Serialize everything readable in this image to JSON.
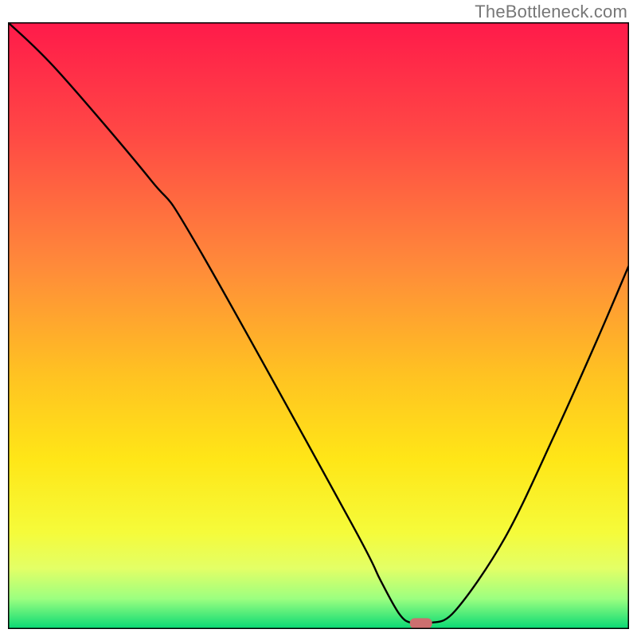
{
  "attribution": "TheBottleneck.com",
  "chart_data": {
    "type": "line",
    "title": "",
    "xlabel": "",
    "ylabel": "",
    "xlim": [
      0,
      100
    ],
    "ylim": [
      0,
      100
    ],
    "x": [
      0,
      8,
      23,
      30,
      55,
      60,
      63,
      65,
      68,
      72,
      80,
      88,
      95,
      100
    ],
    "values": [
      100,
      92,
      74,
      64,
      18,
      8,
      2.5,
      1,
      1,
      3,
      15,
      32,
      48,
      60
    ],
    "marker": {
      "x": 66.5,
      "y": 1
    },
    "gradient_stops": [
      {
        "pct": 0,
        "color": "#ff1a4a"
      },
      {
        "pct": 18,
        "color": "#ff4745"
      },
      {
        "pct": 40,
        "color": "#ff8a3a"
      },
      {
        "pct": 58,
        "color": "#ffc222"
      },
      {
        "pct": 72,
        "color": "#ffe617"
      },
      {
        "pct": 84,
        "color": "#f5fb3a"
      },
      {
        "pct": 90,
        "color": "#e3ff66"
      },
      {
        "pct": 95,
        "color": "#9cff80"
      },
      {
        "pct": 100,
        "color": "#06d874"
      }
    ]
  }
}
